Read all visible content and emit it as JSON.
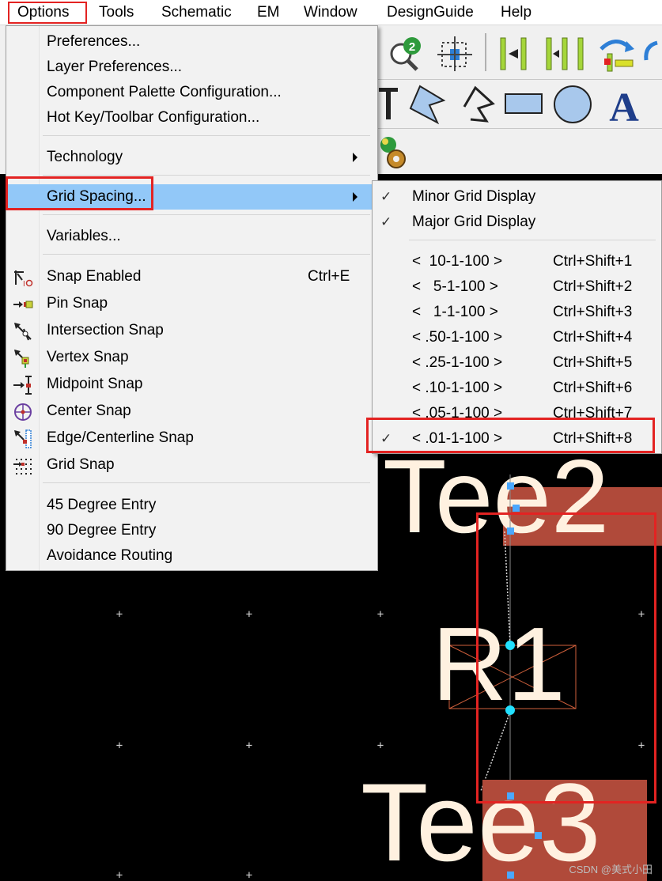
{
  "menubar": {
    "items": [
      "Options",
      "Tools",
      "Schematic",
      "EM",
      "Window",
      "DesignGuide",
      "Help"
    ],
    "active": "Options"
  },
  "options_menu": {
    "preferences": "Preferences...",
    "layer_preferences": "Layer Preferences...",
    "component_palette": "Component Palette Configuration...",
    "hotkey_toolbar": "Hot Key/Toolbar Configuration...",
    "technology": "Technology",
    "grid_spacing": "Grid Spacing...",
    "variables": "Variables...",
    "snap_enabled": "Snap Enabled",
    "snap_enabled_shortcut": "Ctrl+E",
    "pin_snap": "Pin Snap",
    "intersection_snap": "Intersection Snap",
    "vertex_snap": "Vertex Snap",
    "midpoint_snap": "Midpoint Snap",
    "center_snap": "Center Snap",
    "edge_centerline_snap": "Edge/Centerline Snap",
    "grid_snap": "Grid Snap",
    "deg45": "45 Degree Entry",
    "deg90": "90 Degree Entry",
    "avoidance_routing": "Avoidance Routing"
  },
  "grid_submenu": {
    "minor_grid": "Minor Grid Display",
    "major_grid": "Major Grid Display",
    "check_glyph": "✓",
    "options": [
      {
        "label": "<  10-1-100 >",
        "shortcut": "Ctrl+Shift+1"
      },
      {
        "label": "<   5-1-100 >",
        "shortcut": "Ctrl+Shift+2"
      },
      {
        "label": "<   1-1-100 >",
        "shortcut": "Ctrl+Shift+3"
      },
      {
        "label": "< .50-1-100 >",
        "shortcut": "Ctrl+Shift+4"
      },
      {
        "label": "< .25-1-100 >",
        "shortcut": "Ctrl+Shift+5"
      },
      {
        "label": "< .10-1-100 >",
        "shortcut": "Ctrl+Shift+6"
      },
      {
        "label": "< .05-1-100 >",
        "shortcut": "Ctrl+Shift+7"
      },
      {
        "label": "< .01-1-100 >",
        "shortcut": "Ctrl+Shift+8"
      }
    ],
    "selected_index": 7
  },
  "canvas": {
    "labels": {
      "tee2": "Tee2",
      "r1": "R1",
      "tee3": "Tee3"
    }
  },
  "watermark": "CSDN @美式小田",
  "colors": {
    "highlight": "#92c8f8",
    "annotation_red": "#e32322",
    "component_fill": "#b04a3a",
    "canvas_bg": "#000000"
  }
}
